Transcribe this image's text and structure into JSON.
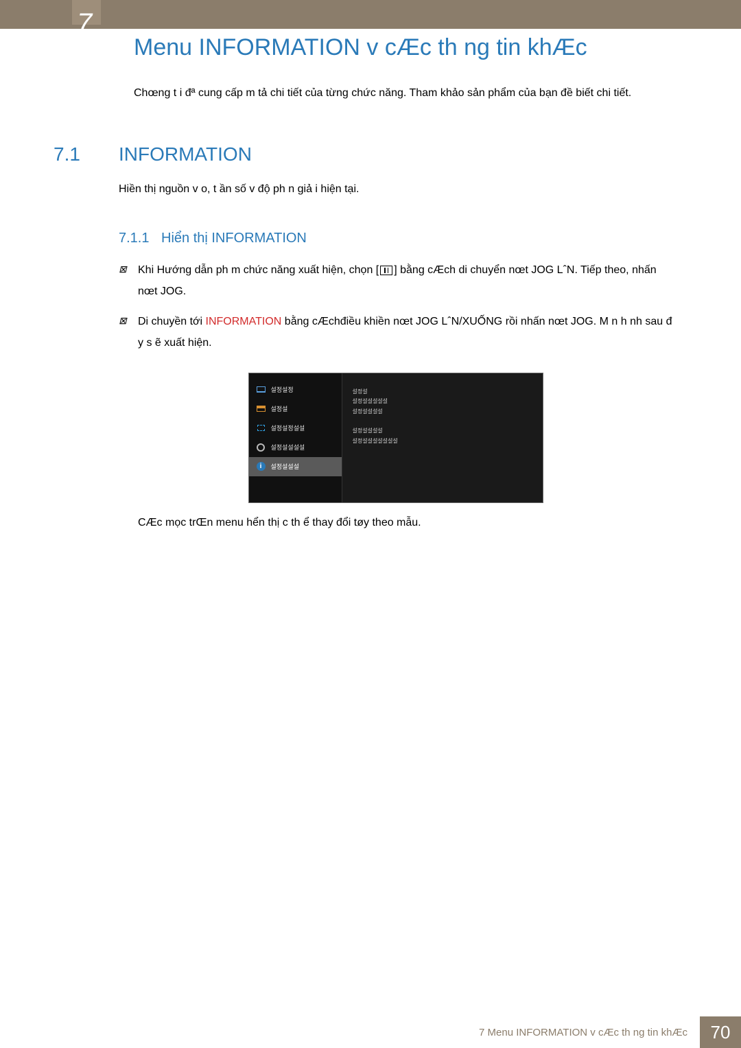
{
  "chapter_number": "7",
  "main_title": "Menu INFORMATION v  cÆc th ng tin khÆc",
  "intro": "Chœng t i đª cung cấp m  tả chi tiết của từng chức năng. Tham khảo sản phẩm của bạn đề biết chi tiết.",
  "section": {
    "num": "7.1",
    "title": "INFORMATION"
  },
  "para1": "Hiền thị nguồn v o, t ần số v  độ  ph n giả i hiện tại.",
  "subsection": {
    "num": "7.1.1",
    "title": "Hiển thị INFORMATION"
  },
  "step1_a": "Khi Hướng dẫn ph m chức năng xuất hiện, chọn [",
  "step1_b": "] bằng cÆch di chuyển nœt JOG LˆN. Tiếp theo, nhấn nœt JOG.",
  "step2_a": "Di chuyền tới ",
  "step2_hl": "INFORMATION",
  "step2_b": " bằng cÆchđiều khiền nœt JOG LˆN/XUỐNG rồi nhấn nœt JOG. M n h nh sau  đ y s ẽ xuất hiện.",
  "osd": {
    "items": [
      "설정설정",
      "설정설",
      "설정설정설설",
      "설정설설설설",
      "설정설설설"
    ],
    "right_l1": "설정설",
    "right_l2": "설정설설설설설",
    "right_l3": "설정설설설설",
    "right_l4": "설정설설설설",
    "right_l5": "설정설설설설설설설"
  },
  "note": "CÆc mọc trŒn menu hển thị c  th ể thay đổi tøy theo mẫu.",
  "footer": {
    "text": "7 Menu INFORMATION v  cÆc th ng tin khÆc",
    "page": "70"
  }
}
